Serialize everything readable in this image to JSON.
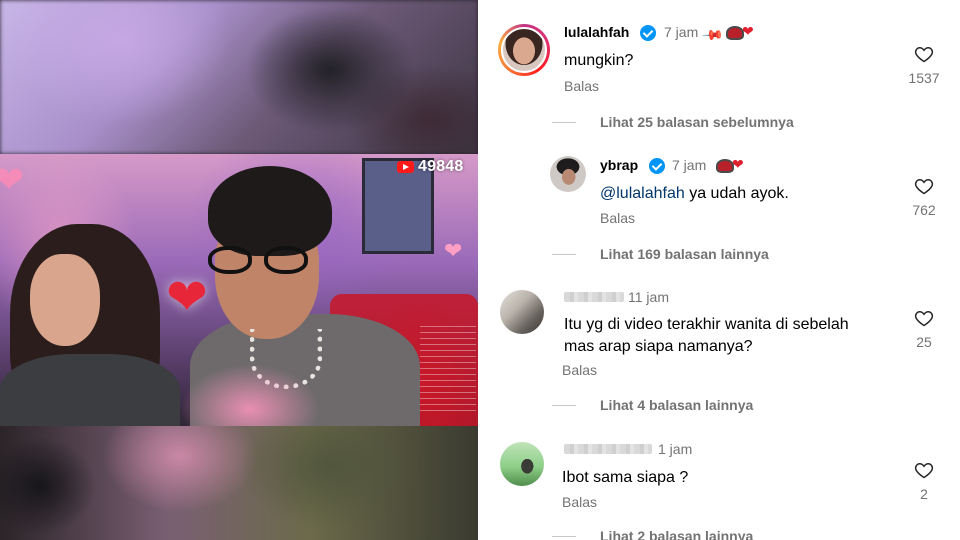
{
  "media": {
    "live_view_count": "49848"
  },
  "comments": [
    {
      "username": "lulalahfah",
      "verified": true,
      "time": "7 jam",
      "pinned": true,
      "text": "mungkin?",
      "reply_label": "Balas",
      "likes": "1537"
    }
  ],
  "view_previous": "Lihat 25 balasan sebelumnya",
  "reply": {
    "username": "ybrap",
    "verified": true,
    "time": "7 jam",
    "mention": "@lulalahfah",
    "text": " ya udah ayok.",
    "reply_label": "Balas",
    "likes": "762"
  },
  "view_more_1": "Lihat 169 balasan lainnya",
  "comment3": {
    "time": "11 jam",
    "text_line1": "Itu yg di video terakhir wanita di sebelah",
    "text_line2": "mas arap siapa namanya?",
    "reply_label": "Balas",
    "likes": "25"
  },
  "view_more_2": "Lihat 4 balasan lainnya",
  "comment4": {
    "time": "1 jam",
    "text": "Ibot sama siapa ?",
    "reply_label": "Balas",
    "likes": "2"
  },
  "view_more_3": "Lihat 2 balasan lainnya",
  "colors": {
    "verified_blue": "#0095f6",
    "secondary_text": "#737373",
    "mention": "#00376b",
    "yt_red": "#ff1a1a"
  }
}
